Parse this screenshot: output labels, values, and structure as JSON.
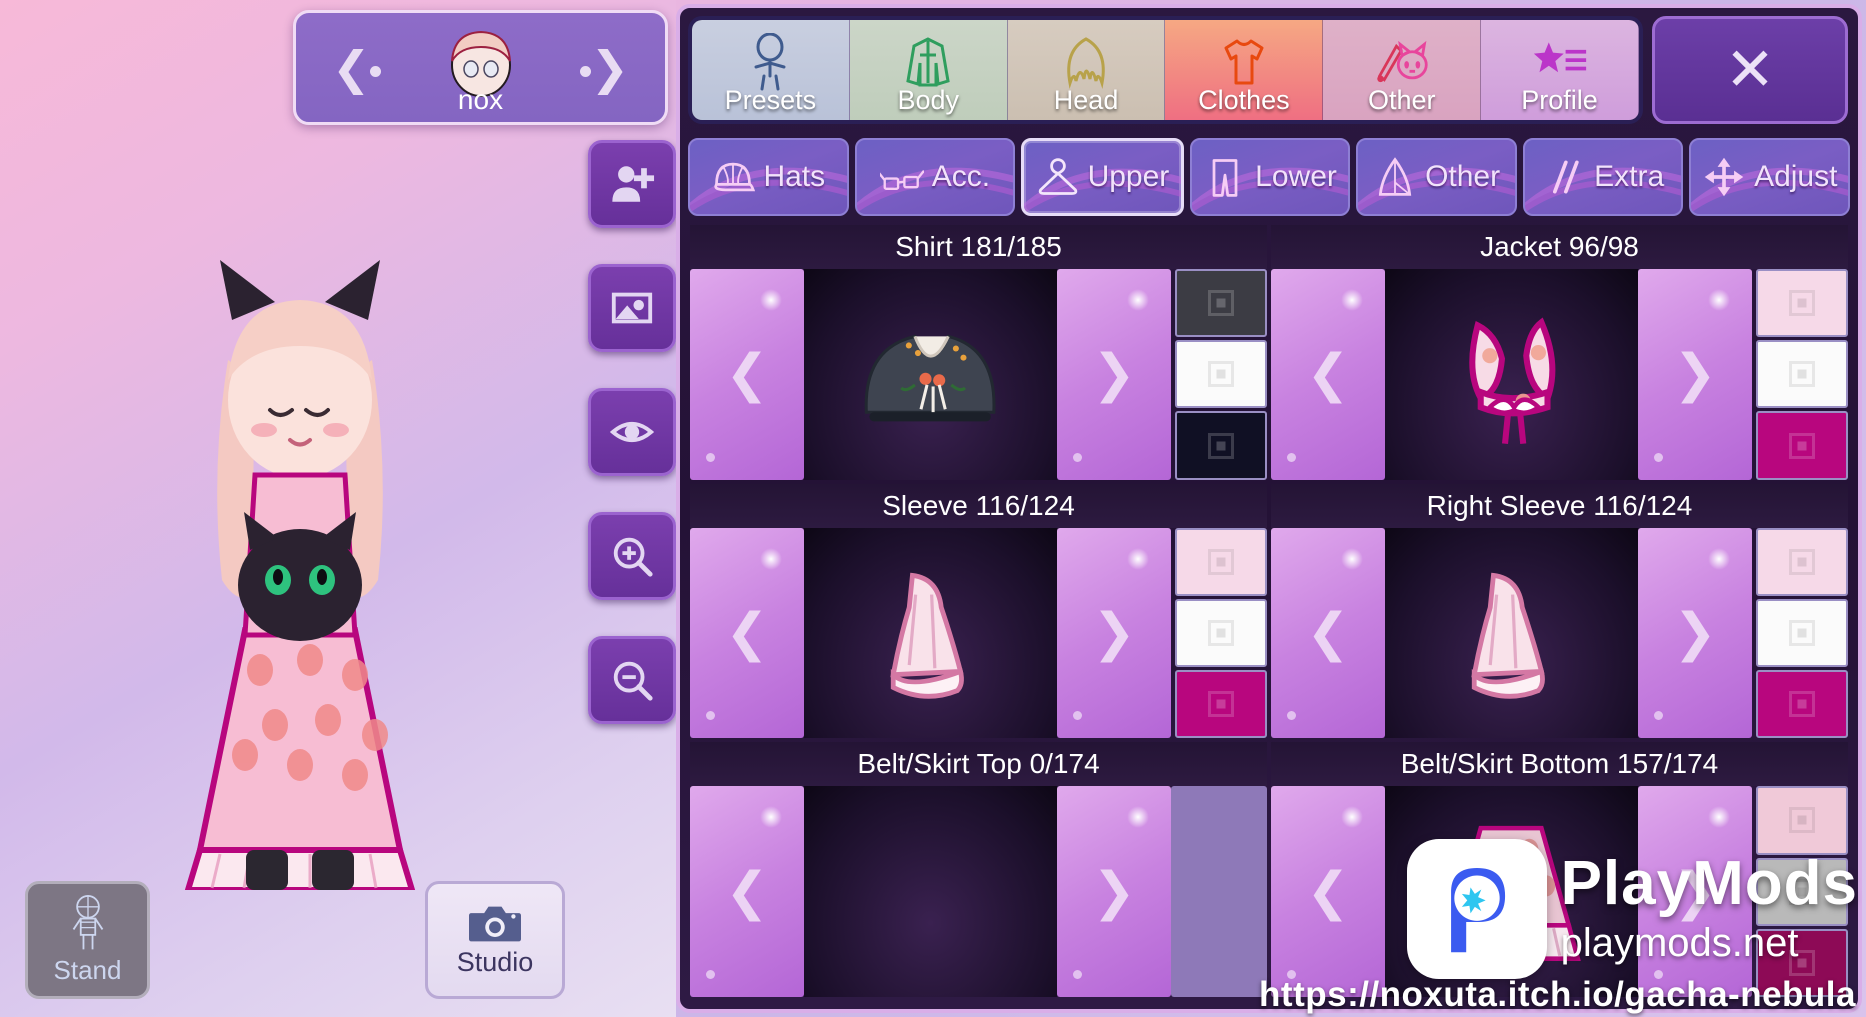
{
  "character": {
    "name": "nox",
    "prev_icon": "chevron-left-icon",
    "next_icon": "chevron-right-icon",
    "avatar_icon": "character-head-icon"
  },
  "stage_tools": [
    {
      "icon": "add-person-icon",
      "name": "add-character-button"
    },
    {
      "icon": "image-icon",
      "name": "background-button"
    },
    {
      "icon": "eye-icon",
      "name": "visibility-button"
    },
    {
      "icon": "zoom-in-icon",
      "name": "zoom-in-button"
    },
    {
      "icon": "zoom-out-icon",
      "name": "zoom-out-button"
    }
  ],
  "stand_button": {
    "label": "Stand",
    "icon": "stand-pose-icon"
  },
  "studio_button": {
    "label": "Studio",
    "icon": "camera-icon"
  },
  "main_tabs": [
    {
      "label": "Presets",
      "icon": "character-outline-icon",
      "active": false
    },
    {
      "label": "Body",
      "icon": "jacket-icon",
      "active": false
    },
    {
      "label": "Head",
      "icon": "hair-icon",
      "active": false
    },
    {
      "label": "Clothes",
      "icon": "tshirt-icon",
      "active": true
    },
    {
      "label": "Other",
      "icon": "sword-cat-icon",
      "active": false
    },
    {
      "label": "Profile",
      "icon": "star-list-icon",
      "active": false
    }
  ],
  "close_button": {
    "label": "✕",
    "icon": "close-icon"
  },
  "sub_tabs": [
    {
      "label": "Hats",
      "icon": "cap-icon",
      "selected": false
    },
    {
      "label": "Acc.",
      "icon": "glasses-icon",
      "selected": false
    },
    {
      "label": "Upper",
      "icon": "hanger-icon",
      "selected": true
    },
    {
      "label": "Lower",
      "icon": "pants-icon",
      "selected": false
    },
    {
      "label": "Other",
      "icon": "cape-icon",
      "selected": false
    },
    {
      "label": "Extra",
      "icon": "slashes-icon",
      "selected": false
    },
    {
      "label": "Adjust",
      "icon": "move-arrows-icon",
      "selected": false
    }
  ],
  "items": [
    {
      "title": "Shirt 181/185",
      "prev_icon": "chevron-left-icon",
      "next_icon": "chevron-right-icon",
      "preview_icon": "dark-shirt-preview",
      "swatches": [
        {
          "color": "#3c3c44",
          "dark": true
        },
        {
          "color": "#fbfbfb",
          "dark": false
        },
        {
          "color": "#101024",
          "dark": true
        }
      ]
    },
    {
      "title": "Jacket 96/98",
      "prev_icon": "chevron-left-icon",
      "next_icon": "chevron-right-icon",
      "preview_icon": "pink-jacket-preview",
      "swatches": [
        {
          "color": "#f6d9e8",
          "dark": false
        },
        {
          "color": "#fbfbfb",
          "dark": false
        },
        {
          "color": "#b8067e",
          "dark": true
        }
      ]
    },
    {
      "title": "Sleeve 116/124",
      "prev_icon": "chevron-left-icon",
      "next_icon": "chevron-right-icon",
      "preview_icon": "pink-sleeve-preview",
      "swatches": [
        {
          "color": "#f6d9e8",
          "dark": false
        },
        {
          "color": "#fbfbfb",
          "dark": false
        },
        {
          "color": "#b8067e",
          "dark": true
        }
      ]
    },
    {
      "title": "Right Sleeve 116/124",
      "prev_icon": "chevron-left-icon",
      "next_icon": "chevron-right-icon",
      "preview_icon": "pink-sleeve-preview",
      "swatches": [
        {
          "color": "#f6d9e8",
          "dark": false
        },
        {
          "color": "#fbfbfb",
          "dark": false
        },
        {
          "color": "#b8067e",
          "dark": true
        }
      ]
    },
    {
      "title": "Belt/Skirt Top 0/174",
      "prev_icon": "chevron-left-icon",
      "next_icon": "chevron-right-icon",
      "preview_icon": "empty-preview",
      "swatches": []
    },
    {
      "title": "Belt/Skirt Bottom 157/174",
      "prev_icon": "chevron-left-icon",
      "next_icon": "chevron-right-icon",
      "preview_icon": "strawberry-skirt-preview",
      "swatches": [
        {
          "color": "#f0c9d8",
          "dark": false
        },
        {
          "color": "#b9b9b9",
          "dark": false
        },
        {
          "color": "#8d0a56",
          "dark": true
        }
      ]
    }
  ],
  "watermark": {
    "title": "PlayMods",
    "subtitle": "playmods.net",
    "url": "https://noxuta.itch.io/gacha-nebula",
    "logo_icon": "playmods-logo-icon"
  },
  "colors": {
    "accent": "#8e6cc8",
    "active_tab": "#ef6f82",
    "panel_bg": "#2b1840",
    "panel_border": "#d9aee8"
  }
}
